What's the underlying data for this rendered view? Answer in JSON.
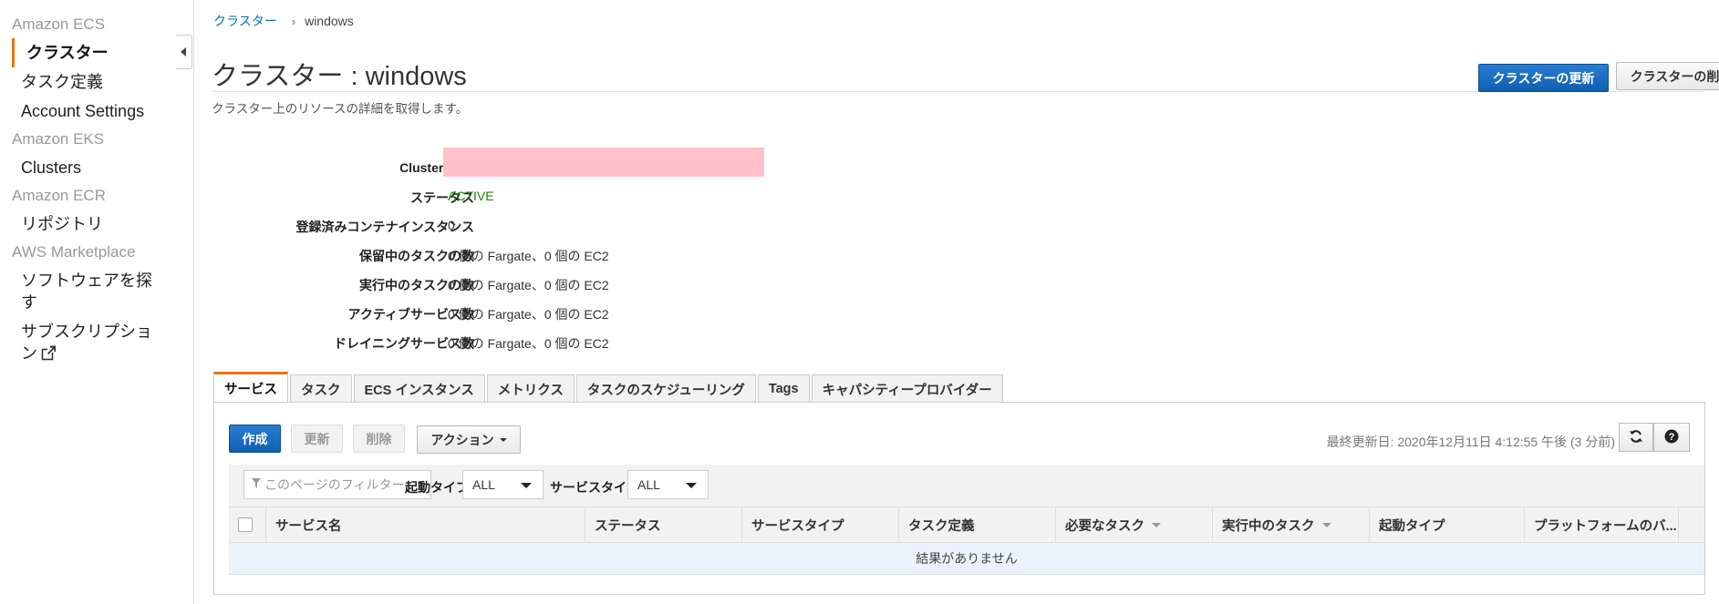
{
  "sidebar": {
    "sections": [
      {
        "title": "Amazon ECS",
        "items": [
          "クラスター",
          "タスク定義",
          "Account Settings"
        ]
      },
      {
        "title": "Amazon EKS",
        "items": [
          "Clusters"
        ]
      },
      {
        "title": "Amazon ECR",
        "items": [
          "リポジトリ"
        ]
      },
      {
        "title": "AWS Marketplace",
        "items": [
          "ソフトウェアを探す",
          "サブスクリプション"
        ]
      }
    ]
  },
  "breadcrumb": {
    "link": "クラスター",
    "separator": "›",
    "current": "windows"
  },
  "header": {
    "title": "クラスター : windows",
    "subtitle": "クラスター上のリソースの詳細を取得します。",
    "update_button": "クラスターの更新",
    "delete_button": "クラスターの削除"
  },
  "details": {
    "cluster_arn_label": "Cluster ARN",
    "cluster_arn_value": "",
    "status_label": "ステータス",
    "status_value": "ACTIVE",
    "registered_label": "登録済みコンテナインスタンス",
    "registered_value": "0",
    "pending_label": "保留中のタスクの数",
    "pending_value": "0 個の Fargate、0 個の EC2",
    "running_label": "実行中のタスクの数",
    "running_value": "0 個の Fargate、0 個の EC2",
    "active_services_label": "アクティブサービス数",
    "active_services_value": "0 個の Fargate、0 個の EC2",
    "draining_label": "ドレイニングサービス数",
    "draining_value": "0 個の Fargate、0 個の EC2"
  },
  "tabs": [
    "サービス",
    "タスク",
    "ECS インスタンス",
    "メトリクス",
    "タスクのスケジューリング",
    "Tags",
    "キャパシティープロバイダー"
  ],
  "toolbar": {
    "create": "作成",
    "update": "更新",
    "delete": "削除",
    "actions": "アクション",
    "last_updated": "最終更新日: 2020年12月11日 4:12:55 午後 (3 分前)"
  },
  "filters": {
    "placeholder": "このページのフィルター",
    "launch_type_label": "起動タイプ",
    "launch_type_value": "ALL",
    "service_type_label": "サービスタイプ",
    "service_type_value": "ALL"
  },
  "table": {
    "columns": [
      "サービス名",
      "ステータス",
      "サービスタイプ",
      "タスク定義",
      "必要なタスク",
      "実行中のタスク",
      "起動タイプ",
      "プラットフォームのバ..."
    ],
    "empty_message": "結果がありません"
  },
  "colors": {
    "accent": "#ec7211",
    "primary": "#1166bb",
    "active_status": "#1d8102",
    "redaction": "#ffc0cb"
  }
}
